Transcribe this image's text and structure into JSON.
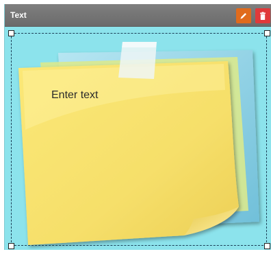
{
  "widget": {
    "title": "Text",
    "edit_icon": "pencil-icon",
    "delete_icon": "trash-icon"
  },
  "note": {
    "text": "Enter text"
  },
  "colors": {
    "background": "#8ce3ec",
    "titlebar": "#757575",
    "edit_button": "#e06b1c",
    "delete_button": "#e0393a",
    "note_yellow": "#f7e36f",
    "back_paper_blue": "#87cfe4",
    "tape": "#e9f3f4"
  }
}
